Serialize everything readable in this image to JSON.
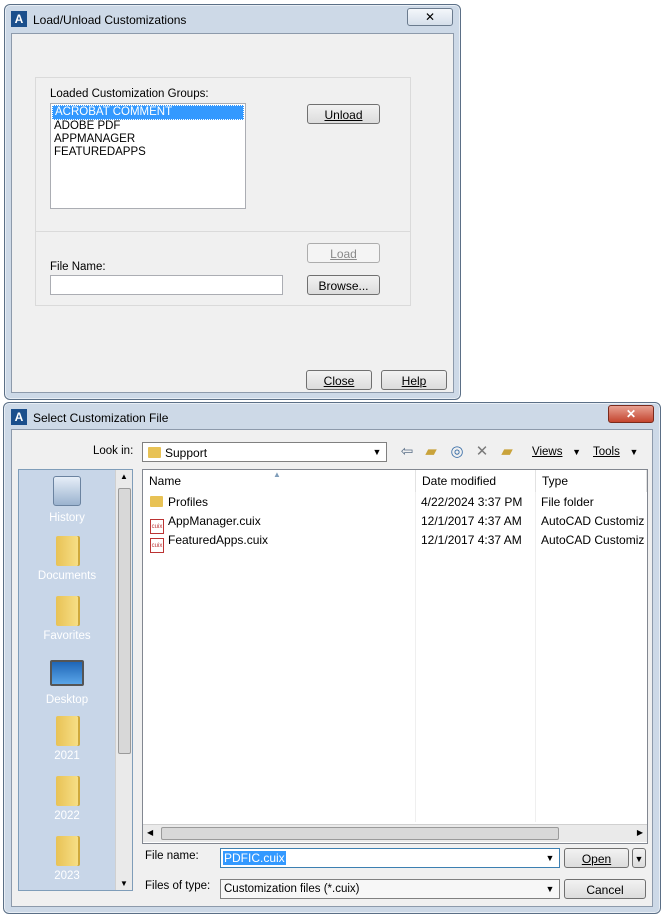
{
  "dialog1": {
    "title": "Load/Unload Customizations",
    "close_glyph": "✕",
    "groups_label": "Loaded Customization Groups:",
    "groups": [
      "ACROBAT COMMENT",
      "ADOBE PDF",
      "APPMANAGER",
      "FEATUREDAPPS"
    ],
    "selected_group": "ACROBAT COMMENT",
    "unload_label": "Unload",
    "load_label": "Load",
    "file_name_label": "File Name:",
    "file_name_value": "",
    "browse_label": "Browse...",
    "close_label": "Close",
    "help_label": "Help"
  },
  "dialog2": {
    "title": "Select Customization File",
    "close_glyph": "✕",
    "look_in_label": "Look in:",
    "look_in_value": "Support",
    "views_label": "Views",
    "tools_label": "Tools",
    "places": [
      {
        "label": "History",
        "icon": "history-icon"
      },
      {
        "label": "Documents",
        "icon": "folder-icon"
      },
      {
        "label": "Favorites",
        "icon": "folder-icon"
      },
      {
        "label": "Desktop",
        "icon": "desktop-icon"
      },
      {
        "label": "2021",
        "icon": "folder-icon"
      },
      {
        "label": "2022",
        "icon": "folder-icon"
      },
      {
        "label": "2023",
        "icon": "folder-icon"
      }
    ],
    "columns": [
      "Name",
      "Date modified",
      "Type"
    ],
    "files": [
      {
        "name": "Profiles",
        "date": "4/22/2024 3:37 PM",
        "type": "File folder",
        "icon": "folder-icon"
      },
      {
        "name": "AppManager.cuix",
        "date": "12/1/2017 4:37 AM",
        "type": "AutoCAD Customization File",
        "icon": "cuix-file-icon"
      },
      {
        "name": "FeaturedApps.cuix",
        "date": "12/1/2017 4:37 AM",
        "type": "AutoCAD Customization File",
        "icon": "cuix-file-icon"
      }
    ],
    "file_name_label": "File name:",
    "file_name_value": "PDFIC.cuix",
    "files_of_type_label": "Files of type:",
    "files_of_type_value": "Customization files (*.cuix)",
    "open_label": "Open",
    "cancel_label": "Cancel"
  }
}
